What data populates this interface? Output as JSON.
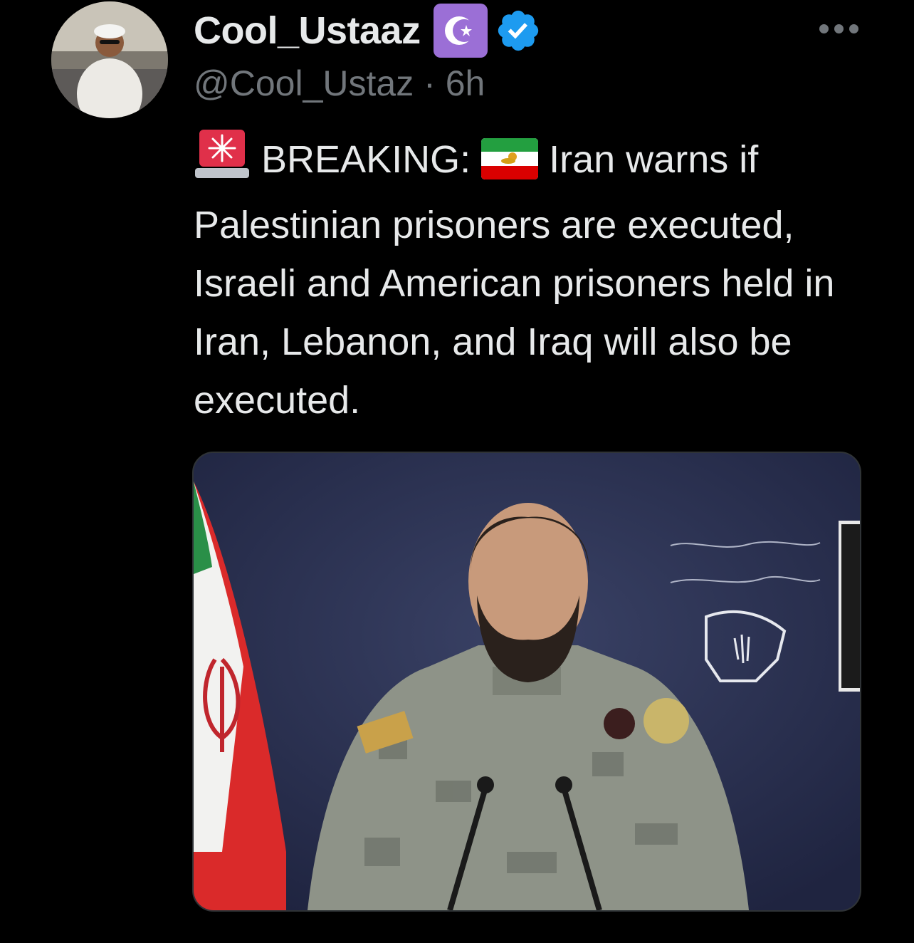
{
  "author": {
    "display_name": "Cool_Ustaaz",
    "handle": "@Cool_Ustaz",
    "separator": "·",
    "time": "6h"
  },
  "badges": {
    "crescent_icon": "crescent-star-icon",
    "verified_icon": "verified-check-icon",
    "verified_color": "#1d9bf0"
  },
  "tweet": {
    "prefix_emoji": "rotating-light-icon",
    "breaking_label": "BREAKING:",
    "flag_emoji": "iran-lion-sun-flag-icon",
    "body": "Iran warns if Palestinian prisoners are executed, Israeli and American prisoners held in Iran, Lebanon, and Iraq will also be executed."
  },
  "media": {
    "image": "officer-at-podium-photo",
    "overlay_text": "أذن للذين يقاتلون بأنهم ظلموا وإن الله على نصرهم لقدير"
  }
}
